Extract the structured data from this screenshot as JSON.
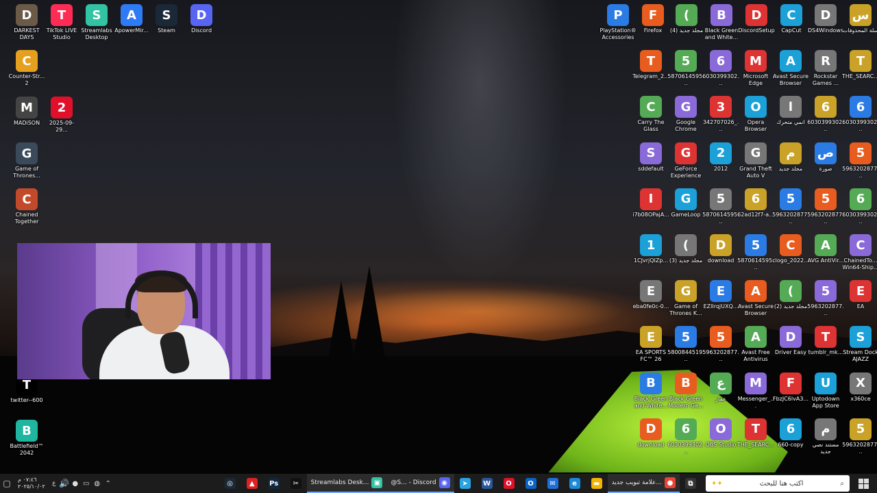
{
  "desktop": {
    "left_icons": [
      {
        "label": "DARKEST DAYS",
        "icon": "darkest-days-icon",
        "color": "#6b5a48"
      },
      {
        "label": "TikTok LIVE Studio",
        "icon": "tiktok-icon",
        "color": "#fe2c55"
      },
      {
        "label": "Streamlabs Desktop",
        "icon": "streamlabs-icon",
        "color": "#31c3a2"
      },
      {
        "label": "ApowerMir...",
        "icon": "apowermirror-icon",
        "color": "#2f7bf5"
      },
      {
        "label": "Steam",
        "icon": "steam-icon",
        "color": "#1b2838"
      },
      {
        "label": "Discord",
        "icon": "discord-icon",
        "color": "#5865f2"
      },
      {
        "label": "Counter-Str... 2",
        "icon": "counter-strike-icon",
        "color": "#e6a020"
      },
      {
        "label": "MADiSON",
        "icon": "madison-icon",
        "color": "#444"
      },
      {
        "label": "2025-09-29...",
        "icon": "opera-icon",
        "color": "#e0102a"
      },
      {
        "label": "Game of Thrones...",
        "icon": "game-of-thrones-icon",
        "color": "#3a4a5a"
      },
      {
        "label": "Chained Together",
        "icon": "chained-together-icon",
        "color": "#c24a2a"
      },
      {
        "label": "twitter--600",
        "icon": "x-twitter-icon",
        "color": "#000"
      },
      {
        "label": "Battlefield™ 2042",
        "icon": "battlefield-icon",
        "color": "#1fb5a0"
      }
    ],
    "right_icons": [
      [
        "PlayStation® Accessories",
        "Firefox",
        "(4) مجلد جديد",
        "Black Green and White...",
        "DiscordSetup",
        "CapCut",
        "DS4Windows",
        "سلة المحذوفات"
      ],
      [
        "Telegram_2...",
        "5870614595...",
        "6030399302...",
        "Microsoft Edge",
        "Avast Secure Browser",
        "Rockstar Games ...",
        "THE_SEARC..."
      ],
      [
        "Carry The Glass",
        "Google Chrome",
        "342707026_...",
        "Opera Browser",
        "انمي متحرك",
        "6030399302...",
        "6030399302..."
      ],
      [
        "sddefault",
        "GeForce Experience",
        "2012",
        "Grand Theft Auto V",
        "مجلد جديد",
        "صورة",
        "5963202877..."
      ],
      [
        "i7b08OPajA...",
        "GameLoop",
        "5870614595...",
        "62ad12f7-a...",
        "5963202877...",
        "5963202877...",
        "6030399302..."
      ],
      [
        "1CJvrjQIZp...",
        "(3) مجلد جديد",
        "download",
        "5870614595...",
        "clogo_2022...",
        "AVG AntiVir...",
        "ChainedTo... Win64-Ship..."
      ],
      [
        "eba0fe0c-0...",
        "Game of Thrones K...",
        "EZlIrqjUXQ...",
        "Avast Secure Browser",
        "(2) مجلد جديد",
        "5963202877...",
        "EA"
      ],
      [
        "EA SPORTS FC™ 26",
        "5800844519...",
        "5963202877...",
        "Avast Free Antivirus",
        "Driver Easy",
        "tumblr_mk...",
        "Stream Dock AJAZZ"
      ],
      [
        "Black Green and White...",
        "Black Green Modern Ga...",
        "عمار",
        "Messenger_...",
        "FbzJC6lvA3...",
        "Uptodown App Store",
        "x360ce"
      ],
      [
        "download",
        "6030399302...",
        "OBS Studio",
        "THE_SEARC...",
        "660-copy",
        "مستند نصي جديد",
        "5963202877..."
      ]
    ]
  },
  "taskbar": {
    "start_icon": "windows-start-icon",
    "search_placeholder": "اكتب هنا للبحث",
    "pinned": [
      {
        "name": "task-view",
        "glyph": "⧉",
        "color": "#333"
      },
      {
        "name": "chrome",
        "glyph": "●",
        "color": "#ea4335",
        "label": "علامة تبويب جديد..."
      },
      {
        "name": "file-explorer",
        "glyph": "▬",
        "color": "#f2b600"
      },
      {
        "name": "edge",
        "glyph": "e",
        "color": "#1d8ad9"
      },
      {
        "name": "mail",
        "glyph": "✉",
        "color": "#1e6fd9"
      },
      {
        "name": "outlook",
        "glyph": "O",
        "color": "#0a64c8"
      },
      {
        "name": "opera",
        "glyph": "O",
        "color": "#e0102a"
      },
      {
        "name": "word",
        "glyph": "W",
        "color": "#2b579a"
      },
      {
        "name": "telegram",
        "glyph": "➤",
        "color": "#2aa3e0"
      },
      {
        "name": "discord",
        "glyph": "◉",
        "color": "#5865f2",
        "label": "@S... - Discord"
      },
      {
        "name": "streamlabs",
        "glyph": "▣",
        "color": "#31c3a2",
        "label": "Streamlabs Desk..."
      },
      {
        "name": "capcut",
        "glyph": "✂",
        "color": "#111"
      },
      {
        "name": "photoshop",
        "glyph": "Ps",
        "color": "#0f2741"
      },
      {
        "name": "stream-dock",
        "glyph": "▲",
        "color": "#d22"
      },
      {
        "name": "steam",
        "glyph": "◎",
        "color": "#1b2838"
      }
    ],
    "clock_time": "٠٧:٤٦ م",
    "clock_date": "٢٠٢٥/١٠/٠٢",
    "language": "ع"
  }
}
